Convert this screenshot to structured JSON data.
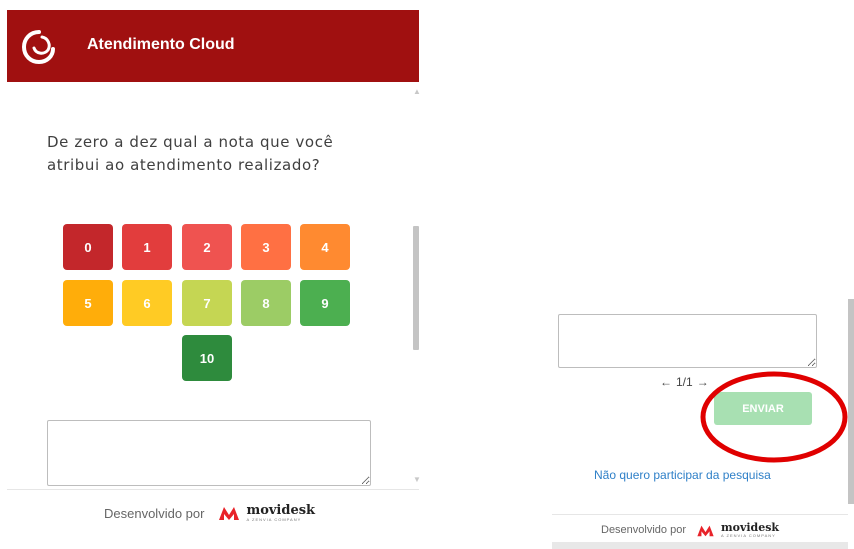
{
  "header": {
    "title": "Atendimento Cloud",
    "logo_icon": "swirl-logo-icon",
    "background": "#a01010"
  },
  "survey": {
    "question": "De zero a dez qual a nota que você atribui ao atendimento realizado?",
    "scores": [
      {
        "label": "0",
        "color": "#c3272b"
      },
      {
        "label": "1",
        "color": "#e23d3d"
      },
      {
        "label": "2",
        "color": "#ef5350"
      },
      {
        "label": "3",
        "color": "#ff7043"
      },
      {
        "label": "4",
        "color": "#ff8a30"
      },
      {
        "label": "5",
        "color": "#ffad0a"
      },
      {
        "label": "6",
        "color": "#ffcb24"
      },
      {
        "label": "7",
        "color": "#c5d653"
      },
      {
        "label": "8",
        "color": "#9ccc65"
      },
      {
        "label": "9",
        "color": "#4caf50"
      },
      {
        "label": "10",
        "color": "#2e8b3d"
      }
    ],
    "comment_left_value": "",
    "comment_right_value": "",
    "pagination": "1/1",
    "submit_label": "ENVIAR",
    "submit_color": "#a8e0b2",
    "opt_out_label": "Não quero participar da pesquisa",
    "highlight_color": "#e00000"
  },
  "footer": {
    "developed_by": "Desenvolvido por",
    "brand": "movidesk",
    "brand_sub": "A ZENVIA COMPANY",
    "brand_color": "#e8232a"
  }
}
